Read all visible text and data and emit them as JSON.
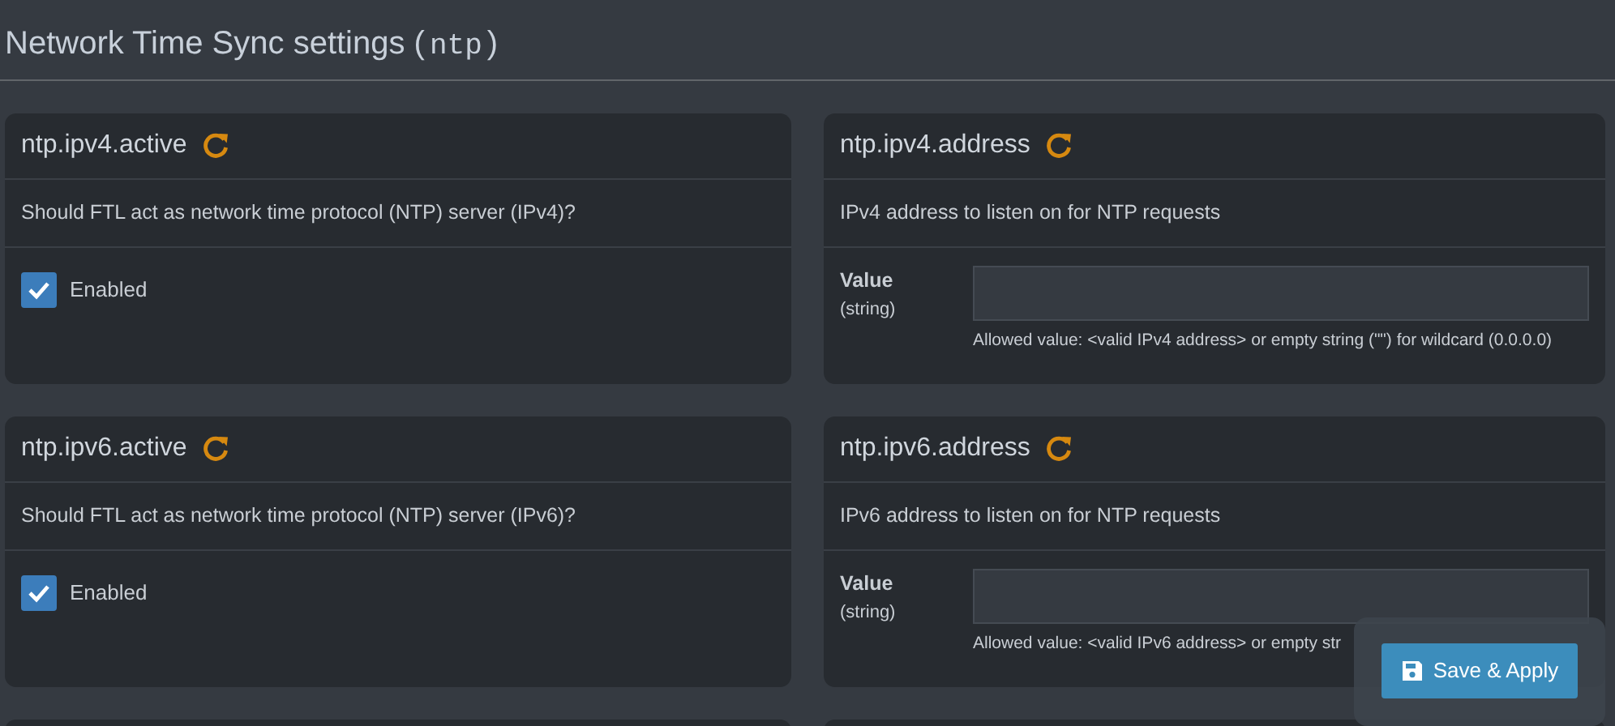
{
  "heading": [
    {
      "kind": "plain",
      "text": "Network Time Sync settings ("
    },
    {
      "kind": "code",
      "text": "ntp"
    },
    {
      "kind": "plain",
      "text": ")"
    }
  ],
  "cards": [
    {
      "kind": "checkbox",
      "title": "ntp.ipv4.active",
      "description": "Should FTL act as network time protocol (NTP) server (IPv4)?",
      "checked": true,
      "label": "Enabled"
    },
    {
      "kind": "text",
      "title": "ntp.ipv4.address",
      "description": "IPv4 address to listen on for NTP requests",
      "value_label": "Value",
      "type_label": "(string)",
      "hint": "Allowed value: <valid IPv4 address> or empty string (\"\") for wildcard (0.0.0.0)"
    },
    {
      "kind": "checkbox",
      "title": "ntp.ipv6.active",
      "description": "Should FTL act as network time protocol (NTP) server (IPv6)?",
      "checked": true,
      "label": "Enabled"
    },
    {
      "kind": "text",
      "title": "ntp.ipv6.address",
      "description": "IPv6 address to listen on for NTP requests",
      "value_label": "Value",
      "type_label": "(string)",
      "hint": "Allowed value: <valid IPv6 address> or empty str"
    },
    {
      "kind": "cut"
    },
    {
      "kind": "cut"
    }
  ],
  "save_button": {
    "label": "Save & Apply"
  }
}
